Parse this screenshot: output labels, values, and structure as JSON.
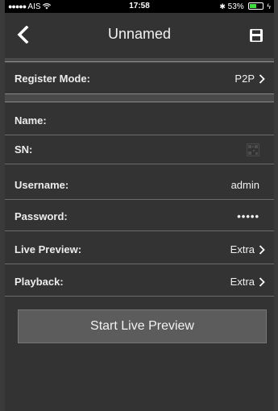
{
  "status_bar": {
    "carrier": "AIS",
    "time": "17:58",
    "battery": "53%"
  },
  "nav": {
    "title": "Unnamed",
    "back_icon": "chevron-left-icon",
    "save_icon": "floppy-disk-icon"
  },
  "fields": {
    "register_mode": {
      "label": "Register Mode:",
      "value": "P2P"
    },
    "name": {
      "label": "Name:",
      "value": ""
    },
    "sn": {
      "label": "SN:",
      "value": ""
    },
    "username": {
      "label": "Username:",
      "value": "admin"
    },
    "password": {
      "label": "Password:",
      "value": "•••••"
    },
    "live_preview": {
      "label": "Live Preview:",
      "value": "Extra"
    },
    "playback": {
      "label": "Playback:",
      "value": "Extra"
    }
  },
  "actions": {
    "start_live_preview": "Start Live Preview"
  },
  "colors": {
    "background": "#333333",
    "separator": "#6c6c6c",
    "button": "#5c5c5c"
  }
}
